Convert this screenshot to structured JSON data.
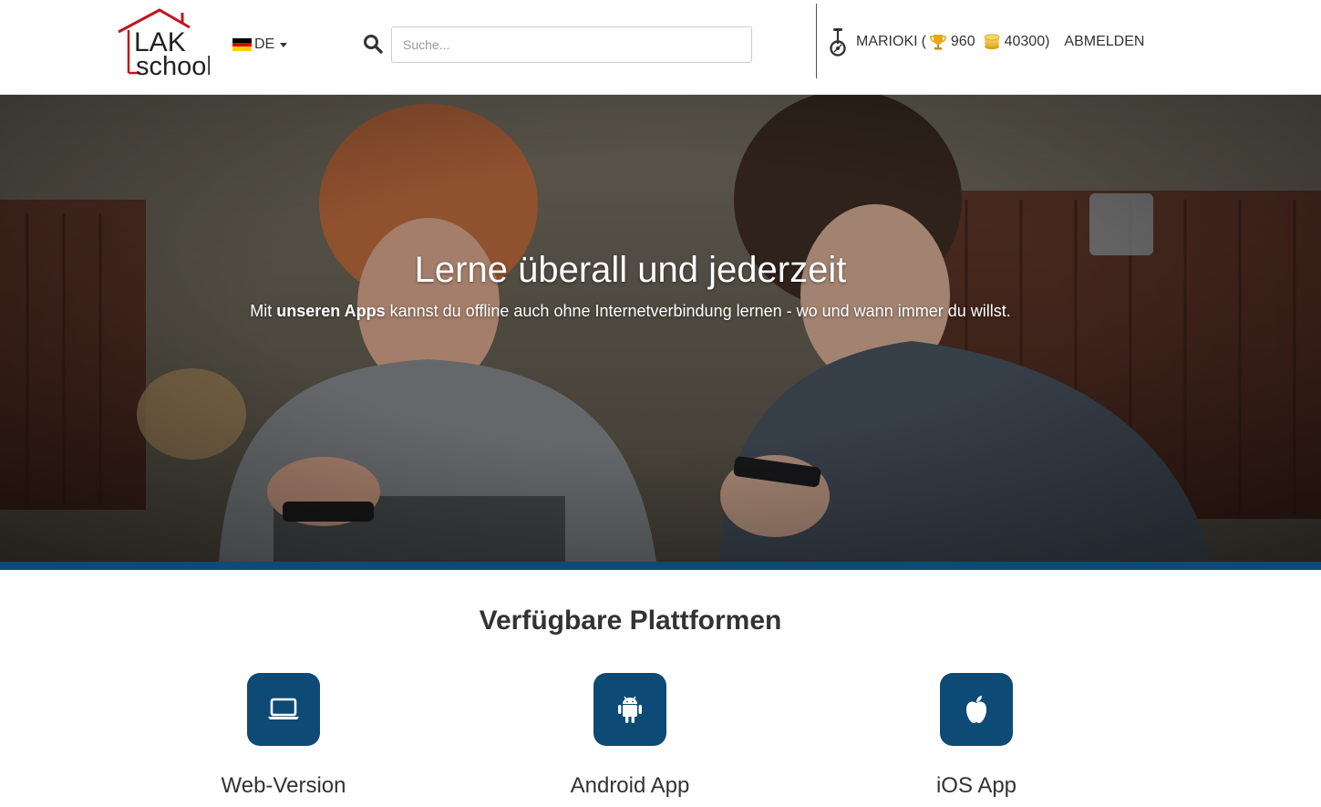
{
  "header": {
    "logo_text_top": "LAK",
    "logo_text_bottom": "school",
    "language": "DE",
    "search_placeholder": "Suche...",
    "user": {
      "name": "MARIOKI",
      "open_paren": "(",
      "trophies": "960",
      "coins": "40300)",
      "logout_label": "ABMELDEN"
    }
  },
  "hero": {
    "title": "Lerne überall und jederzeit",
    "subtitle_prefix": "Mit ",
    "subtitle_bold": "unseren Apps",
    "subtitle_suffix": " kannst du offline auch ohne Internetverbindung lernen - wo und wann immer du willst."
  },
  "platforms": {
    "title": "Verfügbare Plattformen",
    "items": [
      {
        "label": "Web-Version",
        "icon": "laptop-icon"
      },
      {
        "label": "Android App",
        "icon": "android-icon"
      },
      {
        "label": "iOS App",
        "icon": "apple-icon"
      }
    ]
  },
  "colors": {
    "brand_blue": "#0d4a75",
    "logo_red": "#c0171c",
    "trophy_gold": "#e6a817"
  }
}
